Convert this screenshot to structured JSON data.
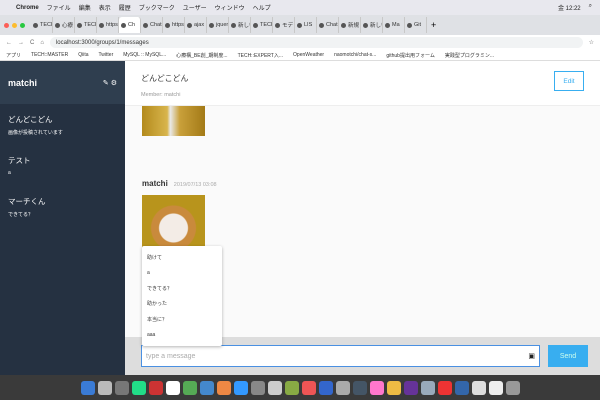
{
  "menubar": {
    "app": "Chrome",
    "items": [
      "ファイル",
      "編集",
      "表示",
      "履歴",
      "ブックマーク",
      "ユーザー",
      "ウィンドウ",
      "ヘルプ"
    ],
    "clock": "金 12:22"
  },
  "tabs": [
    "TECH",
    "心療",
    "TECH",
    "https",
    "Ch",
    "Chat",
    "https",
    "ajax",
    "jquer",
    "新しいタブ",
    "TECH",
    "モデ",
    "LIS",
    "Chat",
    "新規",
    "新しいタ",
    "Ma",
    "Git"
  ],
  "address": {
    "url": "localhost:3000/groups/1/messages"
  },
  "bookmarks": [
    "アプリ",
    "TECH::MASTER",
    "Qiita",
    "Twitter",
    "MySQL :: MySQL...",
    "心療構_BE創_期制度...",
    "TECH::EXPERT入...",
    "OpenWeather",
    "naomotchi/chat-s...",
    "github提出用フォーム",
    "実践型プログラミン..."
  ],
  "sidebar": {
    "user": "matchi",
    "groups": [
      {
        "name": "どんどこどん",
        "last": "画像が投稿されています"
      },
      {
        "name": "テスト",
        "last": "a"
      },
      {
        "name": "マーチくん",
        "last": "できてる？"
      }
    ]
  },
  "main": {
    "title": "どんどこどん",
    "members": "Member: matchi",
    "edit": "Edit",
    "message": {
      "user": "matchi",
      "date": "2019/07/13 03:08"
    }
  },
  "autocomplete": [
    "助けて",
    "a",
    "できてる？",
    "助かった",
    "本当に？",
    "aaa"
  ],
  "form": {
    "placeholder": "type a message",
    "send": "Send"
  },
  "colors": {
    "sidebar": "#253141",
    "accent": "#38aef0"
  }
}
